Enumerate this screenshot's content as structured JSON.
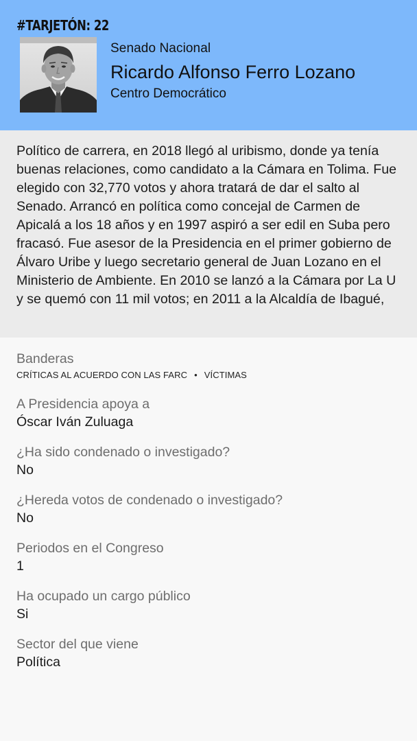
{
  "header": {
    "tag": "#TARJETÓN: 22",
    "chamber": "Senado Nacional",
    "name": "Ricardo Alfonso Ferro Lozano",
    "party": "Centro Democrático",
    "bg_color": "#7db8fb"
  },
  "photo": {
    "icon": "candidate-portrait"
  },
  "bio": {
    "text": "Político de carrera, en 2018 llegó al uribismo, donde ya tenía buenas relaciones, como candidato a la Cámara en Tolima. Fue elegido con 32,770 votos y ahora tratará de dar el salto al Senado. Arrancó en política como concejal de Carmen de Apicalá a los 18 años y en 1997 aspiró a ser edil en Suba pero fracasó. Fue asesor de la Presidencia en el primer gobierno de Álvaro Uribe y luego secretario general de Juan Lozano en el Ministerio de Ambiente. En 2010 se lanzó a la Cámara por La U y se quemó con 11 mil votos; en 2011 a la Alcaldía de Ibagué,"
  },
  "details": {
    "banderas": {
      "label": "Banderas",
      "items": [
        "CRÍTICAS AL ACUERDO CON LAS FARC",
        "VÍCTIMAS"
      ],
      "separator": "•"
    },
    "presidencia": {
      "label": "A Presidencia apoya a",
      "value": "Óscar Iván Zuluaga"
    },
    "condenado": {
      "label": "¿Ha sido condenado o investigado?",
      "value": "No"
    },
    "hereda": {
      "label": "¿Hereda votos de condenado o investigado?",
      "value": "No"
    },
    "periodos": {
      "label": "Periodos en el Congreso",
      "value": "1"
    },
    "cargo": {
      "label": "Ha ocupado un cargo público",
      "value": "Si"
    },
    "sector": {
      "label": "Sector del que viene",
      "value": "Política"
    }
  }
}
